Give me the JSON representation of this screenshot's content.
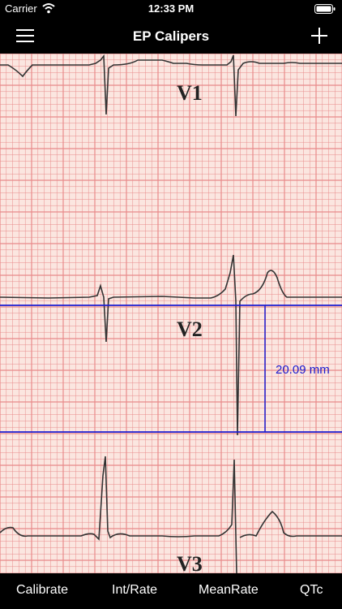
{
  "status_bar": {
    "carrier": "Carrier",
    "time": "12:33 PM"
  },
  "nav": {
    "title": "EP Calipers",
    "menu_icon": "hamburger-menu-icon",
    "add_icon": "plus-icon"
  },
  "ecg": {
    "leads": [
      "V1",
      "V2",
      "V3"
    ],
    "caliper": {
      "orientation": "amplitude",
      "measurement": "20.09 mm",
      "color": "#1c1cd0"
    },
    "grid_color": "#e88a8a",
    "paper_color": "#fbe6e0"
  },
  "tabs": [
    {
      "label": "Calibrate"
    },
    {
      "label": "Int/Rate"
    },
    {
      "label": "MeanRate"
    },
    {
      "label": "QTc"
    }
  ]
}
